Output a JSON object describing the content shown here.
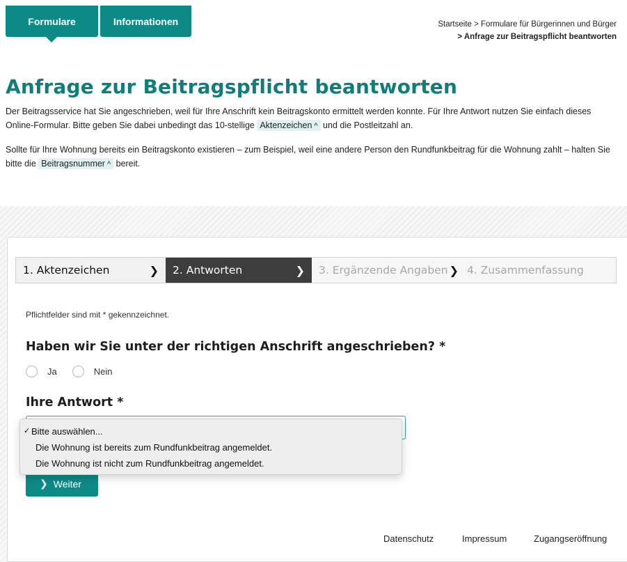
{
  "nav": {
    "tabs": [
      {
        "label": "Formulare",
        "active": true
      },
      {
        "label": "Informationen",
        "active": false
      }
    ]
  },
  "breadcrumb": {
    "home": "Startseite",
    "separator": ">",
    "parent": "Formulare für Bürgerinnen und Bürger",
    "current": "Anfrage zur Beitragspflicht beantworten"
  },
  "page": {
    "title": "Anfrage zur Beitragspflicht beantworten",
    "intro1_a": "Der Beitragsservice hat Sie angeschrieben, weil für Ihre Anschrift kein Beitragskonto ermittelt werden konnte. Für Ihre Antwort nutzen Sie einfach dieses Online-Formular. Bitte geben Sie dabei unbedingt das 10-stellige ",
    "intro1_chip": "Aktenzeichen",
    "intro1_b": " und die Postleitzahl an.",
    "intro2_a": "Sollte für Ihre Wohnung bereits ein Beitragskonto existieren – zum Beispiel, weil eine andere Person den Rundfunkbeitrag für die Wohnung zahlt – halten Sie bitte die ",
    "intro2_chip": "Beitragsnummer",
    "intro2_b": " bereit."
  },
  "stepper": {
    "steps": [
      {
        "label": "1. Aktenzeichen",
        "state": "done"
      },
      {
        "label": "2. Antworten",
        "state": "active"
      },
      {
        "label": "3. Ergänzende Angaben",
        "state": "pending"
      },
      {
        "label": "4. Zusammenfassung",
        "state": "pending"
      }
    ]
  },
  "form": {
    "required_note": "Pflichtfelder sind mit * gekennzeichnet.",
    "question": "Haben wir Sie unter der richtigen Anschrift angeschrieben? *",
    "radio_options": [
      "Ja",
      "Nein"
    ],
    "answer_label": "Ihre Antwort *",
    "dropdown": {
      "selected": "Bitte auswählen...",
      "options": [
        "Bitte auswählen...",
        "Die Wohnung ist bereits zum Rundfunkbeitrag angemeldet.",
        "Die Wohnung ist nicht zum Rundfunkbeitrag angemeldet."
      ]
    },
    "submit_label": "Weiter"
  },
  "footer": {
    "links": [
      "Datenschutz",
      "Impressum",
      "Zugangseröffnung"
    ]
  },
  "colors": {
    "brand": "#0e8a86",
    "title": "#0f7d7a",
    "chip_bg": "#e0f1f0",
    "step_active": "#3d3d3d"
  }
}
